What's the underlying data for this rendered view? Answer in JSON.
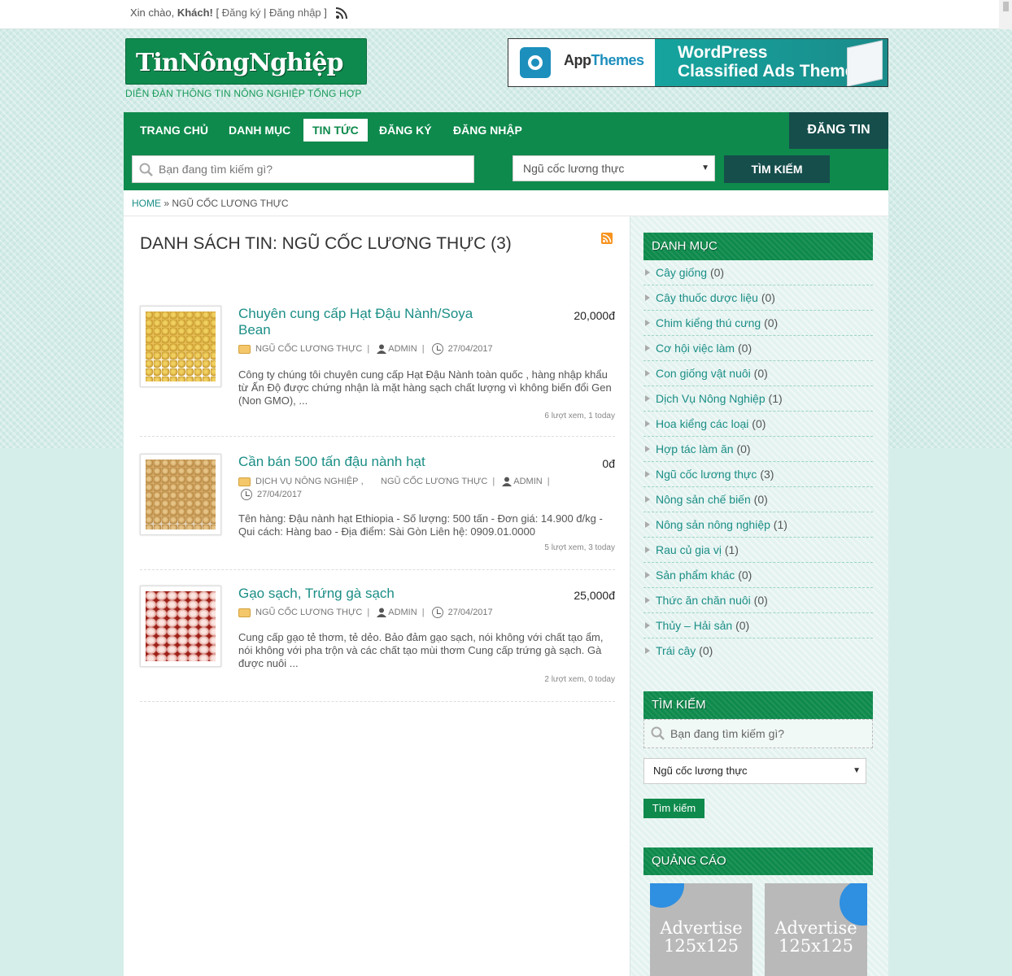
{
  "topbar": {
    "greeting": "Xin chào, ",
    "guest": "Khách!",
    "bracket_open": " [ ",
    "register": "Đăng ký",
    "pipe": " | ",
    "login": "Đăng nhập",
    "bracket_close": " ]"
  },
  "header": {
    "logo": "TinNôngNghiệp",
    "tagline": "DIỄN ĐÀN THÔNG TIN NÔNG NGHIỆP TỔNG HỢP"
  },
  "banner": {
    "brand_a": "App",
    "brand_b": "Themes",
    "title_line1": "WordPress",
    "title_line2": "Classified Ads Theme"
  },
  "nav": {
    "items": [
      "TRANG CHỦ",
      "DANH MỤC",
      "TIN TỨC",
      "ĐĂNG KÝ",
      "ĐĂNG NHẬP"
    ],
    "active_index": 2,
    "post_button": "ĐĂNG TIN"
  },
  "search": {
    "placeholder": "Bạn đang tìm kiếm gì?",
    "category": "Ngũ cốc lương thực",
    "button": "TÌM KIẾM"
  },
  "breadcrumb": {
    "home": "HOME",
    "separator": " » ",
    "current": "NGŨ CỐC LƯƠNG THỰC"
  },
  "main": {
    "title": "DANH SÁCH TIN: NGŨ CỐC LƯƠNG THỰC (3)",
    "listings": [
      {
        "title": "Chuyên cung cấp Hạt Đậu Nành/Soya Bean",
        "price": "20,000đ",
        "category": "NGŨ CỐC LƯƠNG THỰC",
        "author": "ADMIN",
        "date": "27/04/2017",
        "description": "Công ty chúng tôi chuyên cung cấp Hạt Đậu Nành toàn quốc , hàng nhập khẩu từ Ấn Độ được chứng nhận là mặt hàng sạch chất lượng vì không biến đổi Gen (Non GMO), ...",
        "stats": "6 lượt xem, 1 today"
      },
      {
        "title": "Cần bán 500 tấn đậu nành hạt",
        "price": "0đ",
        "category": "DỊCH VỤ NÔNG NGHIỆP",
        "category2": "NGŨ CỐC LƯƠNG THỰC",
        "author": "ADMIN",
        "date": "27/04/2017",
        "description": "Tên hàng: Đậu nành hạt Ethiopia - Số lượng: 500 tấn - Đơn giá: 14.900 đ/kg - Qui cách: Hàng bao - Địa điểm: Sài Gòn Liên hệ: 0909.01.0000",
        "stats": "5 lượt xem, 3 today"
      },
      {
        "title": "Gạo sạch, Trứng gà sạch",
        "price": "25,000đ",
        "category": "NGŨ CỐC LƯƠNG THỰC",
        "author": "ADMIN",
        "date": "27/04/2017",
        "description": "Cung cấp gạo tẻ thơm, tẻ dẻo. Bảo đảm gạo sạch, nói không với chất tạo ẩm, nói không với pha trộn và các chất tạo mùi thơm Cung cấp trứng gà sạch. Gà được nuôi ...",
        "stats": "2 lượt xem, 0 today"
      }
    ]
  },
  "sidebar": {
    "categories_heading": "DANH MỤC",
    "categories": [
      {
        "name": "Cây giống",
        "count": "(0)"
      },
      {
        "name": "Cây thuốc dược liệu",
        "count": "(0)"
      },
      {
        "name": "Chim kiểng thú cưng",
        "count": "(0)"
      },
      {
        "name": "Cơ hội việc làm",
        "count": "(0)"
      },
      {
        "name": "Con giống vật nuôi",
        "count": "(0)"
      },
      {
        "name": "Dịch Vụ Nông Nghiệp",
        "count": "(1)"
      },
      {
        "name": "Hoa kiểng các loại",
        "count": "(0)"
      },
      {
        "name": "Hợp tác làm ăn",
        "count": "(0)"
      },
      {
        "name": "Ngũ cốc lương thực",
        "count": "(3)"
      },
      {
        "name": "Nông sản chế biến",
        "count": "(0)"
      },
      {
        "name": "Nông sản nông nghiệp",
        "count": "(1)"
      },
      {
        "name": "Rau củ gia vị",
        "count": "(1)"
      },
      {
        "name": "Sản phẩm khác",
        "count": "(0)"
      },
      {
        "name": "Thức ăn chăn nuôi",
        "count": "(0)"
      },
      {
        "name": "Thủy – Hải sản",
        "count": "(0)"
      },
      {
        "name": "Trái cây",
        "count": "(0)"
      }
    ],
    "search_heading": "TÌM KIẾM",
    "search_placeholder": "Bạn đang tìm kiếm gì?",
    "search_category": "Ngũ cốc lương thực",
    "search_button": "Tìm kiếm",
    "ads_heading": "QUẢNG CÁO",
    "ad_line1": "Advertise",
    "ad_line2": "125x125"
  }
}
